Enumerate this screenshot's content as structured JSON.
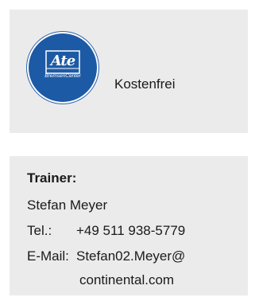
{
  "top_card": {
    "logo": {
      "mark_text": "Ate",
      "subtext": "BremsenCenter",
      "color": "#1d5aa5"
    },
    "price_text": "Kostenfrei"
  },
  "trainer_card": {
    "title": "Trainer:",
    "name": "Stefan Meyer",
    "phone_label": "Tel.:",
    "phone_value": "+49 511 938-5779",
    "email_label": "E-Mail:",
    "email_line1": "Stefan02.Meyer@",
    "email_line2": "continental.com"
  }
}
